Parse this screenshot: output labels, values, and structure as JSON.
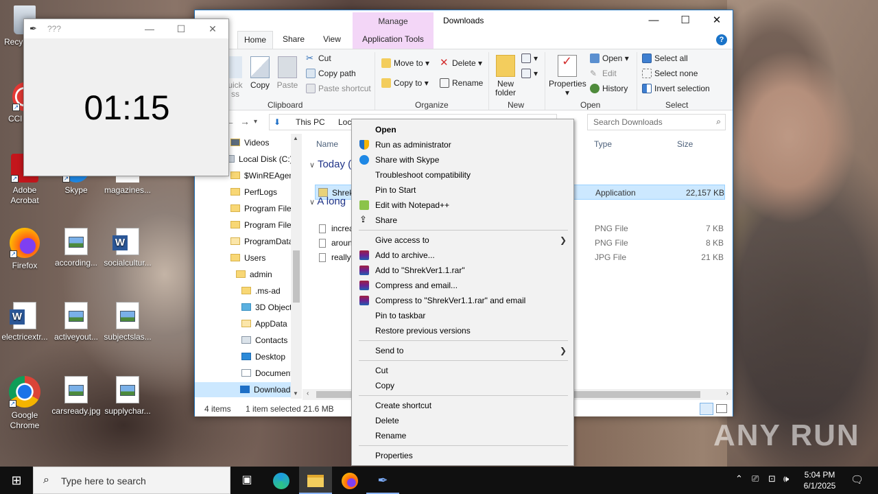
{
  "desktop": {
    "icons": [
      {
        "label": "Recy"
      },
      {
        "label": "CCl"
      },
      {
        "label": "Adobe Acrobat"
      },
      {
        "label": "Skype"
      },
      {
        "label": "magazines..."
      },
      {
        "label": "Firefox"
      },
      {
        "label": "according..."
      },
      {
        "label": "socialcultur..."
      },
      {
        "label": "electricextr..."
      },
      {
        "label": "activeyout..."
      },
      {
        "label": "subjectslas..."
      },
      {
        "label": "Google Chrome"
      },
      {
        "label": "carsready.jpg"
      },
      {
        "label": "supplychar..."
      }
    ],
    "watermark": "ANY RUN"
  },
  "timer_window": {
    "title": "???",
    "time": "01:15"
  },
  "explorer": {
    "contextual_tab": "Manage",
    "window_title": "Downloads",
    "tabs": [
      "Home",
      "Share",
      "View",
      "Application Tools"
    ],
    "ribbon": {
      "clipboard": {
        "label": "Clipboard",
        "quick_access": "uick ss",
        "copy": "Copy",
        "paste": "Paste",
        "cut": "Cut",
        "copy_path": "Copy path",
        "paste_shortcut": "Paste shortcut"
      },
      "organize": {
        "label": "Organize",
        "move_to": "Move to",
        "copy_to": "Copy to",
        "delete": "Delete",
        "rename": "Rename"
      },
      "new": {
        "label": "New",
        "new_folder": "New folder"
      },
      "open": {
        "label": "Open",
        "properties": "Properties",
        "open": "Open",
        "edit": "Edit",
        "history": "History"
      },
      "select": {
        "label": "Select",
        "select_all": "Select all",
        "select_none": "Select none",
        "invert_selection": "Invert selection"
      }
    },
    "address": {
      "crumbs": [
        "This PC",
        "Loc"
      ],
      "search_placeholder": "Search Downloads"
    },
    "nav_items": [
      "Videos",
      "Local Disk (C:)",
      "$WinREAgent",
      "PerfLogs",
      "Program Files",
      "Program Files",
      "ProgramData",
      "Users",
      "admin",
      ".ms-ad",
      "3D Objects",
      "AppData",
      "Contacts",
      "Desktop",
      "Document",
      "Downloads"
    ],
    "columns": {
      "name": "Name",
      "type": "Type",
      "size": "Size"
    },
    "groups": {
      "today": "Today (",
      "long_ago": "A long"
    },
    "files": [
      {
        "name": "ShrekV",
        "type": "Application",
        "size": "22,157 KB"
      },
      {
        "name": "increa",
        "type": "PNG File",
        "size": "7 KB"
      },
      {
        "name": "aroun",
        "type": "PNG File",
        "size": "8 KB"
      },
      {
        "name": "reallyc",
        "type": "JPG File",
        "size": "21 KB"
      }
    ],
    "status": {
      "items": "4 items",
      "selected": "1 item selected",
      "size": "21.6 MB"
    }
  },
  "context_menu": {
    "items": [
      "Open",
      "Run as administrator",
      "Share with Skype",
      "Troubleshoot compatibility",
      "Pin to Start",
      "Edit with Notepad++",
      "Share",
      "Give access to",
      "Add to archive...",
      "Add to \"ShrekVer1.1.rar\"",
      "Compress and email...",
      "Compress to \"ShrekVer1.1.rar\" and email",
      "Pin to taskbar",
      "Restore previous versions",
      "Send to",
      "Cut",
      "Copy",
      "Create shortcut",
      "Delete",
      "Rename",
      "Properties"
    ]
  },
  "taskbar": {
    "search_placeholder": "Type here to search",
    "time": "5:04 PM",
    "date": "6/1/2025"
  },
  "colors": {
    "accent": "#1a73c8",
    "selection": "#cce8ff",
    "manage_tab": "#f3d6f7",
    "taskbar": "#101010"
  }
}
